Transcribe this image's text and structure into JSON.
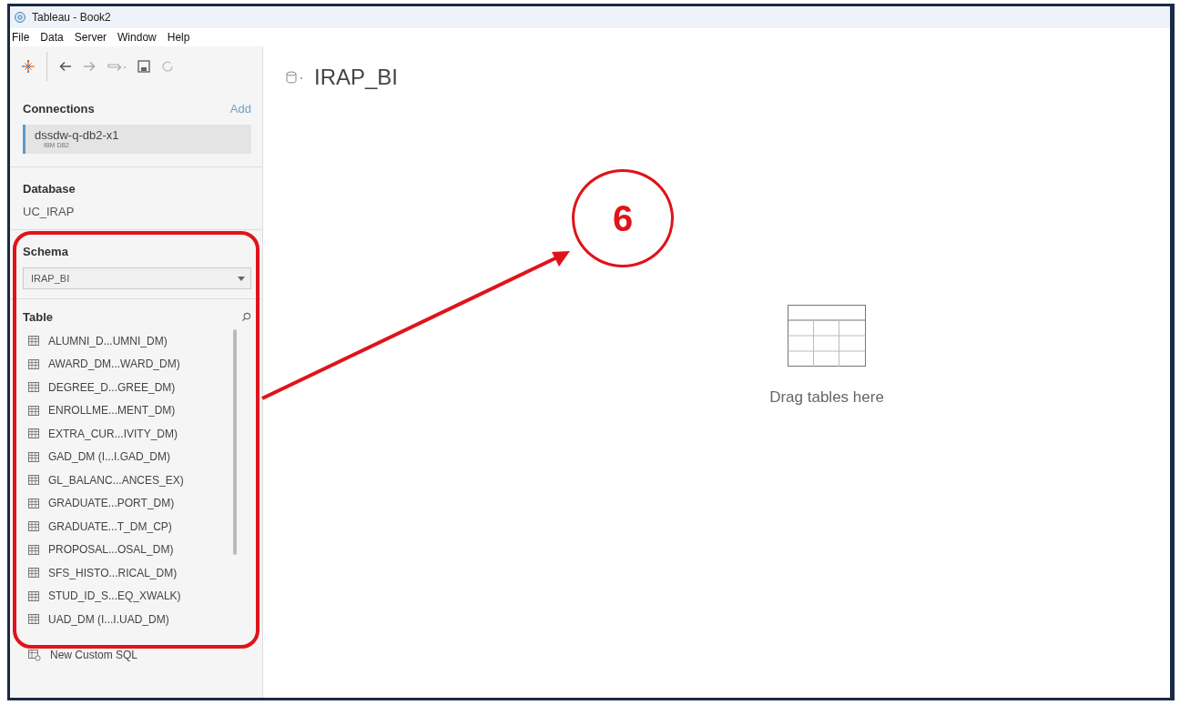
{
  "window": {
    "title": "Tableau - Book2"
  },
  "menu": [
    {
      "label": "File"
    },
    {
      "label": "Data"
    },
    {
      "label": "Server"
    },
    {
      "label": "Window"
    },
    {
      "label": "Help"
    }
  ],
  "connections": {
    "heading": "Connections",
    "add": "Add",
    "items": [
      {
        "name": "dssdw-q-db2-x1",
        "type": "IBM DB2",
        "selected": true
      }
    ]
  },
  "database": {
    "heading": "Database",
    "value": "UC_IRAP"
  },
  "schema": {
    "heading": "Schema",
    "value": "IRAP_BI"
  },
  "tables": {
    "heading": "Table",
    "items": [
      {
        "name": "ALUMNI_D...UMNI_DM)"
      },
      {
        "name": "AWARD_DM...WARD_DM)"
      },
      {
        "name": "DEGREE_D...GREE_DM)"
      },
      {
        "name": "ENROLLME...MENT_DM)"
      },
      {
        "name": "EXTRA_CUR...IVITY_DM)"
      },
      {
        "name": "GAD_DM (I...I.GAD_DM)"
      },
      {
        "name": "GL_BALANC...ANCES_EX)"
      },
      {
        "name": "GRADUATE...PORT_DM)"
      },
      {
        "name": "GRADUATE...T_DM_CP)"
      },
      {
        "name": "PROPOSAL...OSAL_DM)"
      },
      {
        "name": "SFS_HISTO...RICAL_DM)"
      },
      {
        "name": "STUD_ID_S...EQ_XWALK)"
      },
      {
        "name": "UAD_DM (I...I.UAD_DM)"
      }
    ],
    "custom_sql": "New Custom SQL"
  },
  "canvas": {
    "title": "IRAP_BI",
    "hint": "Drag tables here"
  },
  "annotation": {
    "number": "6"
  }
}
